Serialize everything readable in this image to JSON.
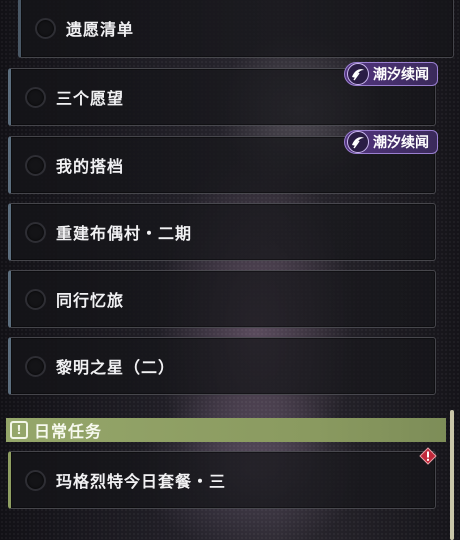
{
  "quests": [
    {
      "title": "遗愿清单",
      "tag": null
    },
    {
      "title": "三个愿望",
      "tag": "潮汐续闻"
    },
    {
      "title": "我的搭档",
      "tag": "潮汐续闻"
    },
    {
      "title": "重建布偶村・二期",
      "tag": null
    },
    {
      "title": "同行忆旅",
      "tag": null
    },
    {
      "title": "黎明之星（二）",
      "tag": null
    }
  ],
  "daily_section": {
    "icon": "exclamation-icon",
    "title": "日常任务"
  },
  "daily_quests": [
    {
      "title": "玛格烈特今日套餐・三",
      "alert_icon": "warning-diamond-icon"
    }
  ],
  "colors": {
    "tag_purple": "#52357e",
    "daily_green": "#95a66a",
    "alert_red": "#c0283a"
  }
}
